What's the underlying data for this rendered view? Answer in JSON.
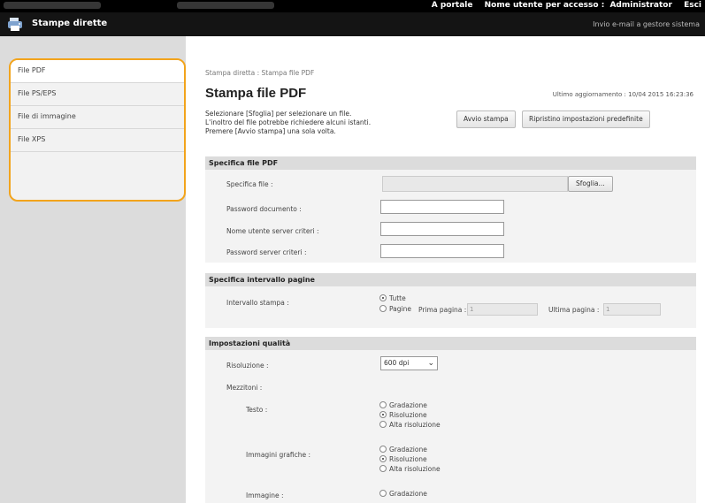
{
  "topbar": {
    "portal_link": "A portale",
    "login_user_label": "Nome utente per accesso :",
    "login_user_value": "Administrator",
    "logout_link": "Esci"
  },
  "header": {
    "title": "Stampe dirette",
    "mail_link": "Invio e-mail a gestore sistema"
  },
  "sidebar": {
    "items": [
      {
        "label": "File PDF"
      },
      {
        "label": "File PS/EPS"
      },
      {
        "label": "File di immagine"
      },
      {
        "label": "File XPS"
      }
    ]
  },
  "main": {
    "breadcrumb": "Stampa diretta : Stampa file PDF",
    "title": "Stampa file PDF",
    "updated": "Ultimo aggiornamento : 10/04 2015 16:23:36",
    "intro": [
      "Selezionare [Sfoglia] per selezionare un file.",
      "L'inoltro del file potrebbe richiedere alcuni istanti.",
      "Premere [Avvio stampa] una sola volta."
    ],
    "start_button": "Avvio stampa",
    "reset_button": "Ripristino impostazioni predefinite"
  },
  "file_section": {
    "heading": "Specifica file PDF",
    "file_label": "Specifica file :",
    "browse_button": "Sfoglia...",
    "doc_password_label": "Password documento :",
    "policy_user_label": "Nome utente server criteri :",
    "policy_password_label": "Password server criteri :"
  },
  "range_section": {
    "heading": "Specifica intervallo pagine",
    "range_label": "Intervallo stampa :",
    "opt_all": "Tutte",
    "opt_pages": "Pagine",
    "first_page_label": "Prima pagina :",
    "first_page_value": "1",
    "last_page_label": "Ultima pagina :",
    "last_page_value": "1"
  },
  "quality_section": {
    "heading": "Impostazioni qualità",
    "resolution_label": "Risoluzione :",
    "resolution_value": "600 dpi",
    "halftone_label": "Mezzitoni :",
    "text_label": "Testo :",
    "graphics_label": "Immagini grafiche :",
    "image_label": "Immagine :",
    "opt_gradation": "Gradazione",
    "opt_resolution": "Risoluzione",
    "opt_high_resolution": "Alta risoluzione"
  }
}
